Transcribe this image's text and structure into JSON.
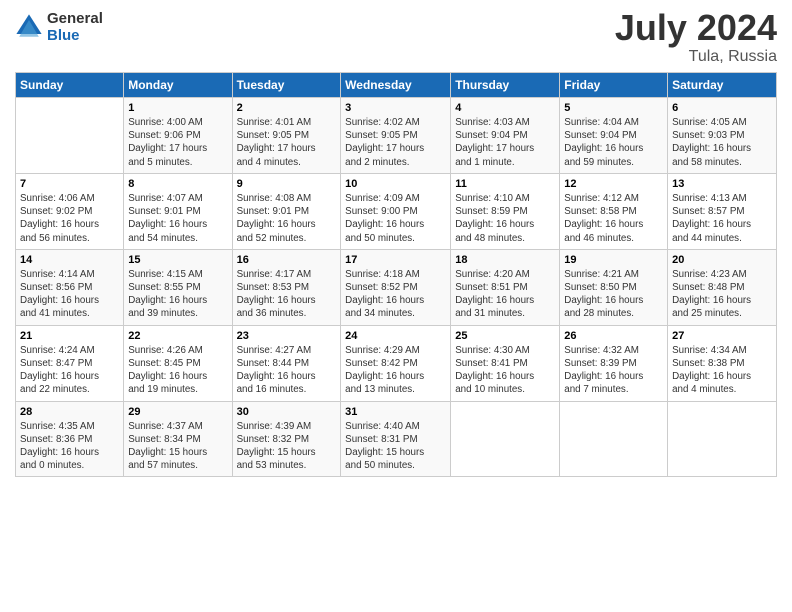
{
  "logo": {
    "line1": "General",
    "line2": "Blue"
  },
  "title": "July 2024",
  "location": "Tula, Russia",
  "days_header": [
    "Sunday",
    "Monday",
    "Tuesday",
    "Wednesday",
    "Thursday",
    "Friday",
    "Saturday"
  ],
  "weeks": [
    [
      {
        "num": "",
        "info": ""
      },
      {
        "num": "1",
        "info": "Sunrise: 4:00 AM\nSunset: 9:06 PM\nDaylight: 17 hours\nand 5 minutes."
      },
      {
        "num": "2",
        "info": "Sunrise: 4:01 AM\nSunset: 9:05 PM\nDaylight: 17 hours\nand 4 minutes."
      },
      {
        "num": "3",
        "info": "Sunrise: 4:02 AM\nSunset: 9:05 PM\nDaylight: 17 hours\nand 2 minutes."
      },
      {
        "num": "4",
        "info": "Sunrise: 4:03 AM\nSunset: 9:04 PM\nDaylight: 17 hours\nand 1 minute."
      },
      {
        "num": "5",
        "info": "Sunrise: 4:04 AM\nSunset: 9:04 PM\nDaylight: 16 hours\nand 59 minutes."
      },
      {
        "num": "6",
        "info": "Sunrise: 4:05 AM\nSunset: 9:03 PM\nDaylight: 16 hours\nand 58 minutes."
      }
    ],
    [
      {
        "num": "7",
        "info": "Sunrise: 4:06 AM\nSunset: 9:02 PM\nDaylight: 16 hours\nand 56 minutes."
      },
      {
        "num": "8",
        "info": "Sunrise: 4:07 AM\nSunset: 9:01 PM\nDaylight: 16 hours\nand 54 minutes."
      },
      {
        "num": "9",
        "info": "Sunrise: 4:08 AM\nSunset: 9:01 PM\nDaylight: 16 hours\nand 52 minutes."
      },
      {
        "num": "10",
        "info": "Sunrise: 4:09 AM\nSunset: 9:00 PM\nDaylight: 16 hours\nand 50 minutes."
      },
      {
        "num": "11",
        "info": "Sunrise: 4:10 AM\nSunset: 8:59 PM\nDaylight: 16 hours\nand 48 minutes."
      },
      {
        "num": "12",
        "info": "Sunrise: 4:12 AM\nSunset: 8:58 PM\nDaylight: 16 hours\nand 46 minutes."
      },
      {
        "num": "13",
        "info": "Sunrise: 4:13 AM\nSunset: 8:57 PM\nDaylight: 16 hours\nand 44 minutes."
      }
    ],
    [
      {
        "num": "14",
        "info": "Sunrise: 4:14 AM\nSunset: 8:56 PM\nDaylight: 16 hours\nand 41 minutes."
      },
      {
        "num": "15",
        "info": "Sunrise: 4:15 AM\nSunset: 8:55 PM\nDaylight: 16 hours\nand 39 minutes."
      },
      {
        "num": "16",
        "info": "Sunrise: 4:17 AM\nSunset: 8:53 PM\nDaylight: 16 hours\nand 36 minutes."
      },
      {
        "num": "17",
        "info": "Sunrise: 4:18 AM\nSunset: 8:52 PM\nDaylight: 16 hours\nand 34 minutes."
      },
      {
        "num": "18",
        "info": "Sunrise: 4:20 AM\nSunset: 8:51 PM\nDaylight: 16 hours\nand 31 minutes."
      },
      {
        "num": "19",
        "info": "Sunrise: 4:21 AM\nSunset: 8:50 PM\nDaylight: 16 hours\nand 28 minutes."
      },
      {
        "num": "20",
        "info": "Sunrise: 4:23 AM\nSunset: 8:48 PM\nDaylight: 16 hours\nand 25 minutes."
      }
    ],
    [
      {
        "num": "21",
        "info": "Sunrise: 4:24 AM\nSunset: 8:47 PM\nDaylight: 16 hours\nand 22 minutes."
      },
      {
        "num": "22",
        "info": "Sunrise: 4:26 AM\nSunset: 8:45 PM\nDaylight: 16 hours\nand 19 minutes."
      },
      {
        "num": "23",
        "info": "Sunrise: 4:27 AM\nSunset: 8:44 PM\nDaylight: 16 hours\nand 16 minutes."
      },
      {
        "num": "24",
        "info": "Sunrise: 4:29 AM\nSunset: 8:42 PM\nDaylight: 16 hours\nand 13 minutes."
      },
      {
        "num": "25",
        "info": "Sunrise: 4:30 AM\nSunset: 8:41 PM\nDaylight: 16 hours\nand 10 minutes."
      },
      {
        "num": "26",
        "info": "Sunrise: 4:32 AM\nSunset: 8:39 PM\nDaylight: 16 hours\nand 7 minutes."
      },
      {
        "num": "27",
        "info": "Sunrise: 4:34 AM\nSunset: 8:38 PM\nDaylight: 16 hours\nand 4 minutes."
      }
    ],
    [
      {
        "num": "28",
        "info": "Sunrise: 4:35 AM\nSunset: 8:36 PM\nDaylight: 16 hours\nand 0 minutes."
      },
      {
        "num": "29",
        "info": "Sunrise: 4:37 AM\nSunset: 8:34 PM\nDaylight: 15 hours\nand 57 minutes."
      },
      {
        "num": "30",
        "info": "Sunrise: 4:39 AM\nSunset: 8:32 PM\nDaylight: 15 hours\nand 53 minutes."
      },
      {
        "num": "31",
        "info": "Sunrise: 4:40 AM\nSunset: 8:31 PM\nDaylight: 15 hours\nand 50 minutes."
      },
      {
        "num": "",
        "info": ""
      },
      {
        "num": "",
        "info": ""
      },
      {
        "num": "",
        "info": ""
      }
    ]
  ]
}
